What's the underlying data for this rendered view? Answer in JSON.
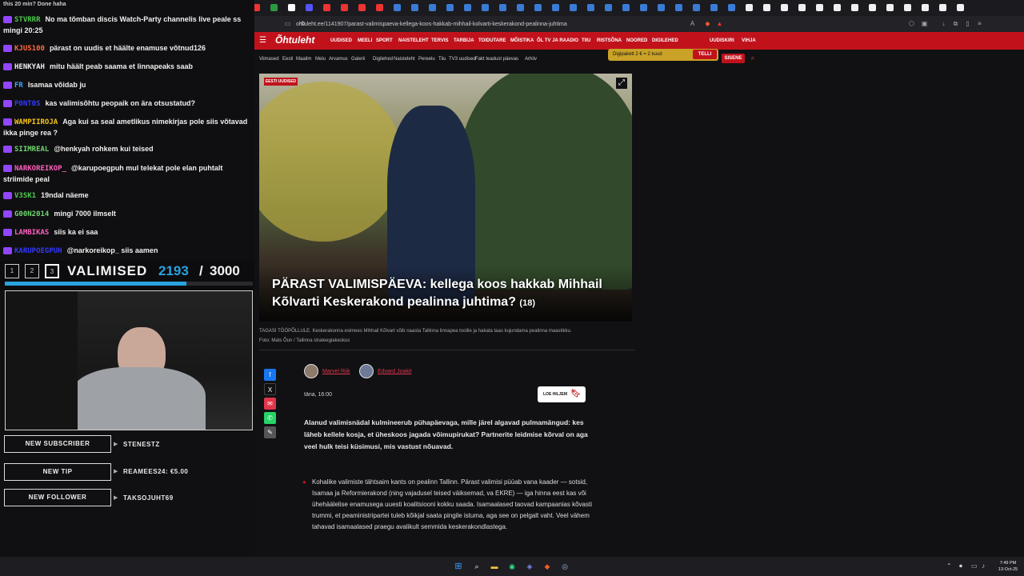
{
  "chat": {
    "top_text": "this 20 min? Done haha",
    "messages": [
      {
        "user": "STVRRR",
        "user_color": "#4ec94e",
        "text": "No ma tõmban discis Watch-Party channelis live peale ss mingi 20:25"
      },
      {
        "user": "KJUS100",
        "user_color": "#ff6a3d",
        "text": "pärast on uudis et häälte enamuse võtnud126"
      },
      {
        "user": "HENKYAH",
        "user_color": "#f0f0f0",
        "text": "mitu häält peab saama et linnapeaks saab"
      },
      {
        "user": "FR",
        "user_color": "#3da5ff",
        "text": "Isamaa võidab ju"
      },
      {
        "user": "P0NT0S",
        "user_color": "#3338ff",
        "text": "kas valimisõhtu peopaik on ära otsustatud?"
      },
      {
        "user": "WAMPIIROJA",
        "user_color": "#f5c518",
        "text": "Aga kui sa seal ametlikus nimekirjas pole siis võtavad ikka pinge rea ?"
      },
      {
        "user": "SIIMREAL",
        "user_color": "#6fd66f",
        "text": "@henkyah rohkem kui teised"
      },
      {
        "user": "NARKOREIKOP_",
        "user_color": "#ff5fbf",
        "text": "@karupoegpuh mul telekat pole elan puhtalt striimide peal"
      },
      {
        "user": "V3SK1",
        "user_color": "#4ec94e",
        "text": "19ndal näeme"
      },
      {
        "user": "G00N2014",
        "user_color": "#6fd66f",
        "text": "mingi 7000 ilmselt"
      },
      {
        "user": "LAMBIKAS",
        "user_color": "#ff5fbf",
        "text": "siis ka ei saa"
      },
      {
        "user": "KARUPOEGPUH",
        "user_color": "#3338ff",
        "text": "@narkoreikop_ siis aamen"
      }
    ]
  },
  "overlay": {
    "boxes": [
      "1",
      "2",
      "3"
    ],
    "title": "VALIMISED",
    "count": "2193",
    "separator": "/",
    "total": "3000",
    "progress_fraction": 0.731,
    "alerts": [
      {
        "label": "NEW SUBSCRIBER",
        "value": "STENESTZ"
      },
      {
        "label": "NEW TIP",
        "value": "REAMEES24: €5.00"
      },
      {
        "label": "NEW FOLLOWER",
        "value": "TAKSOJUHT69"
      }
    ]
  },
  "browser": {
    "url": "ohtuleht.ee/1141907/parast-valimispaeva-kellega-koos-hakkab-mihhail-kolvarti-keskerakond-pealinna-juhtima"
  },
  "site": {
    "logo": "Õhtuleht",
    "nav": [
      "UUDISED",
      "MEELI",
      "SPORT",
      "NAISTELEHT",
      "TERVIS",
      "TARBIJA",
      "TOIDUTARE",
      "MÕISTIKA",
      "ÕL TV JA RAADIO",
      "TIIU",
      "RISTSÕNA",
      "NOORED",
      "DIGILEHED"
    ],
    "nav_right": [
      "UUDISKIRI",
      "VIHJA"
    ],
    "subnav": [
      "Viimased",
      "Eesti",
      "Maailm",
      "Melu",
      "Arvamus",
      "Galerii",
      "Digilehed",
      "Naisteleht",
      "Pereelu",
      "Tiiu",
      "TV3 uudised",
      "Fakt teadust päevas",
      "Arhiiv"
    ],
    "promo_text": "Digipakett 2 € = 2 kuud",
    "promo_button": "TELLI",
    "signin": "SISENE"
  },
  "article": {
    "tag": "EESTI UUDISED",
    "title": "PÄRAST VALIMISPÄEVA: kellega koos hakkab Mihhail Kõlvarti Keskerakond pealinna juhtima?",
    "comments": "(18)",
    "caption": "TAGASI TÖÖPÕLLULE. Keskerakonna esimees Mihhail Kõlvart võib naasta Tallinna linnapea toolile ja hakata taas kujundama pealinna maastikku.",
    "photo_credit": "Foto: Mats Õun / Tallinna strateegiakeskus",
    "authors": [
      "Marvel Riik",
      "Edvard Joakit"
    ],
    "date": "täna, 16:00",
    "save_label": "LOE HILJEM",
    "lead": "Alanud valimisnädal kulmineerub pühapäevaga, mille järel algavad pulmamängud: kes läheb kellele kosja, et üheskoos jagada võimupirukat? Partnerite leidmise kõrval on aga veel hulk teisi küsimusi, mis vastust nõuavad.",
    "bullet": "Kohalike valimiste tähtsaim kants on pealinn Tallinn. Pärast valimisi püüab vana kaader — sotsid, Isamaa ja Reformierakond (ning vajadusel teised väiksemad, va EKRE) — iga hinna eest kas või ühehäälelise enamusega uuesti koalitsiooni kokku saada. Isamaalased taovad kampaanias kõvasti trummi, et peaministripartei tuleb kõikjal saata pingile istuma, aga see on pelgalt vaht. Veel vähem tahavad isamaalased praegu avalikult semmida keskerakondlastega."
  },
  "taskbar": {
    "time": "7:49 PM",
    "date": "13-Oct-25"
  },
  "colors": {
    "accent_red": "#c1121c",
    "overlay_blue": "#2aa2e0",
    "promo_gold": "#c9a227"
  }
}
